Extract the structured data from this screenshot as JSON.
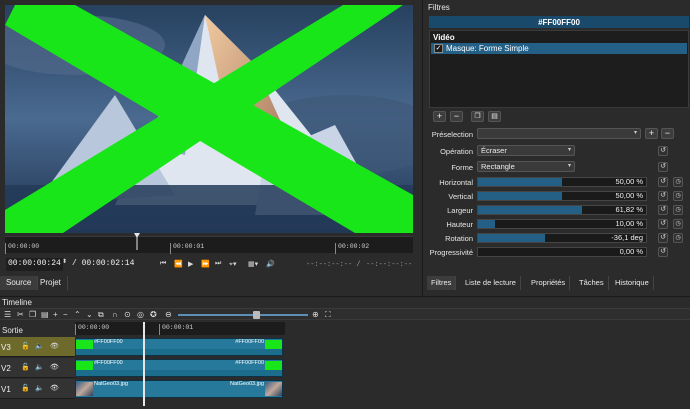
{
  "viewer": {
    "ruler_ticks": [
      "00:00:00",
      "00:00:01",
      "00:00:02"
    ],
    "current_time": "00:00:00:24",
    "total_time": "/ 00:00:02:14",
    "in_point": "--:--:--:-- /",
    "duration": "--:--:--:--",
    "tabs": [
      "Source",
      "Projet"
    ],
    "overlay_color": "#19E619"
  },
  "filters": {
    "title": "Filtres",
    "clip_name": "#FF00FF00",
    "category": "Vidéo",
    "filter_item": "Masque: Forme Simple",
    "filter_enabled": true,
    "preset_label": "Préselection",
    "operation_label": "Opération",
    "operation_value": "Écraser",
    "shape_label": "Forme",
    "shape_value": "Rectangle",
    "params": [
      {
        "label": "Horizontal",
        "value": "50,00 %",
        "fill": 0.5
      },
      {
        "label": "Vertical",
        "value": "50,00 %",
        "fill": 0.5
      },
      {
        "label": "Largeur",
        "value": "61,82 %",
        "fill": 0.618
      },
      {
        "label": "Hauteur",
        "value": "10,00 %",
        "fill": 0.1
      },
      {
        "label": "Rotation",
        "value": "-36,1 deg",
        "fill": 0.4
      },
      {
        "label": "Progressivité",
        "value": "0,00 %",
        "fill": 0
      }
    ],
    "tabs": [
      "Filtres",
      "Liste de lecture",
      "Propriétés",
      "Tâches",
      "Historique"
    ]
  },
  "timeline": {
    "title": "Timeline",
    "output_label": "Sortie",
    "ruler_ticks": [
      "00:00:00",
      "00:00:01"
    ],
    "tracks": [
      {
        "name": "V3",
        "clip_left": "#FF00FF00",
        "clip_right": "#FF00FF00",
        "highlight": true
      },
      {
        "name": "V2",
        "clip_left": "#FF00FF00",
        "clip_right": "#FF00FF00",
        "highlight": false
      },
      {
        "name": "V1",
        "clip_left": "NatGeo03.jpg",
        "clip_right": "NatGeo03.jpg",
        "highlight": false
      }
    ]
  },
  "colors": {
    "accent": "#245F86",
    "clip": "#26799B",
    "green": "#19E619",
    "track_highlight": "#6E6A2B"
  }
}
